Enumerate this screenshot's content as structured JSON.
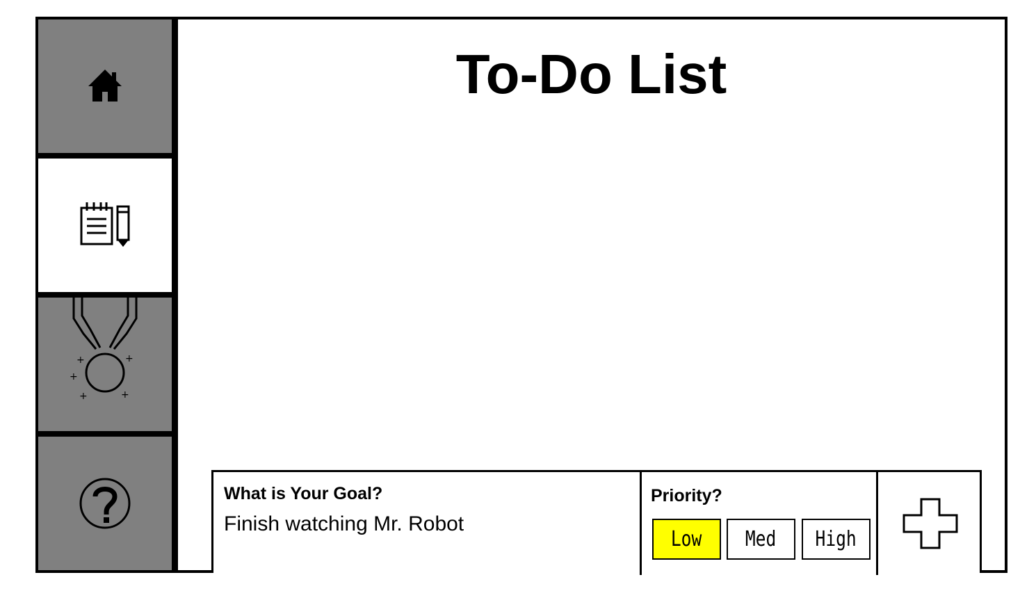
{
  "sidebar": {
    "items": [
      {
        "id": "home",
        "icon": "home-icon",
        "active": false
      },
      {
        "id": "todo",
        "icon": "notepad-pencil-icon",
        "active": true
      },
      {
        "id": "achievements",
        "icon": "medal-icon",
        "active": false
      },
      {
        "id": "help",
        "icon": "question-mark-icon",
        "active": false
      }
    ]
  },
  "main": {
    "title": "To-Do List"
  },
  "entry": {
    "goal_label": "What is Your Goal?",
    "goal_value": "Finish watching Mr. Robot",
    "priority_label": "Priority?",
    "priority_options": [
      "Low",
      "Med",
      "High"
    ],
    "priority_selected": "Low",
    "add_icon": "plus-icon"
  },
  "colors": {
    "sidebar_inactive": "#808080",
    "sidebar_active": "#ffffff",
    "selected_priority": "#ffff00",
    "border": "#000000"
  }
}
